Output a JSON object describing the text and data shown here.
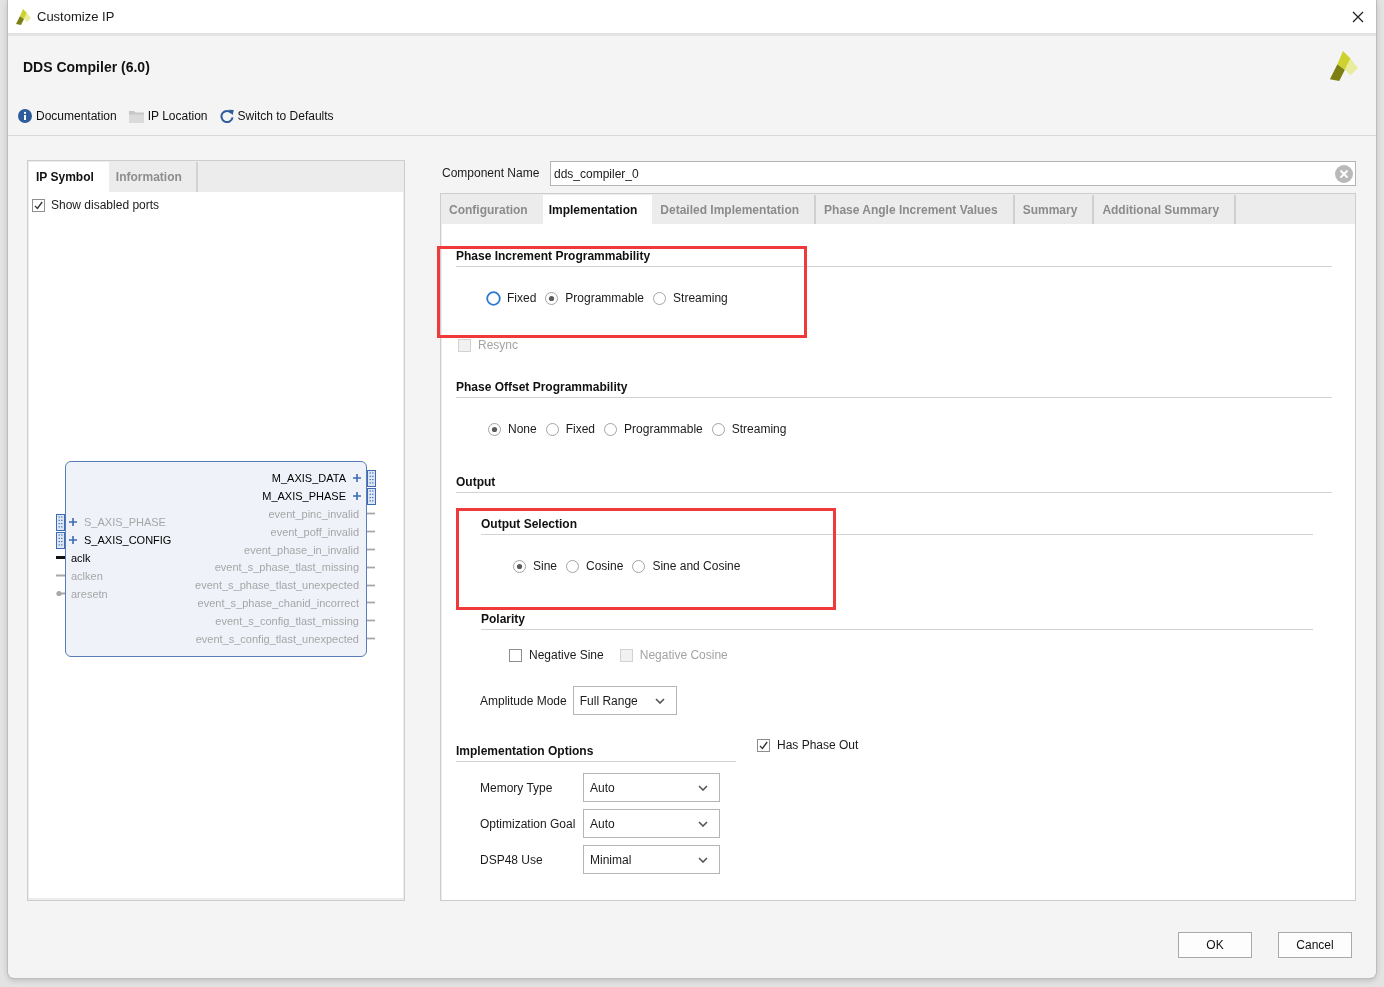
{
  "window": {
    "title": "Customize IP"
  },
  "header": {
    "title": "DDS Compiler (6.0)"
  },
  "toolbar": [
    {
      "kind": "info",
      "label": "Documentation"
    },
    {
      "kind": "folder",
      "label": "IP Location"
    },
    {
      "kind": "refresh",
      "label": "Switch to Defaults"
    }
  ],
  "left_panel": {
    "tabs": [
      {
        "label": "IP Symbol",
        "selected": true
      },
      {
        "label": "Information",
        "selected": false
      }
    ],
    "show_disabled_ports": {
      "label": "Show disabled ports",
      "checked": true
    },
    "symbol": {
      "left_ports": [
        {
          "name": "S_AXIS_PHASE",
          "kind": "bus",
          "disabled": true
        },
        {
          "name": "S_AXIS_CONFIG",
          "kind": "bus",
          "disabled": false
        },
        {
          "name": "aclk",
          "kind": "wire",
          "disabled": false
        },
        {
          "name": "aclken",
          "kind": "wire",
          "disabled": true
        },
        {
          "name": "aresetn",
          "kind": "active_low",
          "disabled": true
        }
      ],
      "right_ports": [
        {
          "name": "M_AXIS_DATA",
          "kind": "bus",
          "disabled": false
        },
        {
          "name": "M_AXIS_PHASE",
          "kind": "bus",
          "disabled": false
        },
        {
          "name": "event_pinc_invalid",
          "kind": "wire",
          "disabled": true
        },
        {
          "name": "event_poff_invalid",
          "kind": "wire",
          "disabled": true
        },
        {
          "name": "event_phase_in_invalid",
          "kind": "wire",
          "disabled": true
        },
        {
          "name": "event_s_phase_tlast_missing",
          "kind": "wire",
          "disabled": true
        },
        {
          "name": "event_s_phase_tlast_unexpected",
          "kind": "wire",
          "disabled": true
        },
        {
          "name": "event_s_phase_chanid_incorrect",
          "kind": "wire",
          "disabled": true
        },
        {
          "name": "event_s_config_tlast_missing",
          "kind": "wire",
          "disabled": true
        },
        {
          "name": "event_s_config_tlast_unexpected",
          "kind": "wire",
          "disabled": true
        }
      ]
    }
  },
  "component_name": {
    "label": "Component Name",
    "value": "dds_compiler_0"
  },
  "tabs": [
    {
      "label": "Configuration",
      "selected": false
    },
    {
      "label": "Implementation",
      "selected": true
    },
    {
      "label": "Detailed Implementation",
      "selected": false
    },
    {
      "label": "Phase Angle Increment Values",
      "selected": false
    },
    {
      "label": "Summary",
      "selected": false
    },
    {
      "label": "Additional Summary",
      "selected": false
    }
  ],
  "implementation": {
    "phase_increment": {
      "title": "Phase Increment Programmability",
      "highlighted": true,
      "options": [
        {
          "label": "Fixed",
          "selected": false,
          "focused": true
        },
        {
          "label": "Programmable",
          "selected": true,
          "focused": false
        },
        {
          "label": "Streaming",
          "selected": false,
          "focused": false
        }
      ]
    },
    "resync": {
      "label": "Resync",
      "checked": false,
      "disabled": true
    },
    "phase_offset": {
      "title": "Phase Offset Programmability",
      "options": [
        {
          "label": "None",
          "selected": true
        },
        {
          "label": "Fixed",
          "selected": false
        },
        {
          "label": "Programmable",
          "selected": false
        },
        {
          "label": "Streaming",
          "selected": false
        }
      ]
    },
    "output": {
      "title": "Output",
      "output_selection": {
        "title": "Output Selection",
        "highlighted": true,
        "options": [
          {
            "label": "Sine",
            "selected": true
          },
          {
            "label": "Cosine",
            "selected": false
          },
          {
            "label": "Sine and Cosine",
            "selected": false
          }
        ]
      },
      "polarity": {
        "title": "Polarity",
        "options": [
          {
            "label": "Negative Sine",
            "checked": false,
            "disabled": false
          },
          {
            "label": "Negative Cosine",
            "checked": false,
            "disabled": true
          }
        ]
      },
      "amplitude_mode": {
        "label": "Amplitude Mode",
        "value": "Full Range"
      }
    },
    "implementation_options": {
      "title": "Implementation Options",
      "fields": [
        {
          "label": "Memory Type",
          "value": "Auto"
        },
        {
          "label": "Optimization Goal",
          "value": "Auto"
        },
        {
          "label": "DSP48 Use",
          "value": "Minimal"
        }
      ]
    },
    "has_phase_out": {
      "label": "Has Phase Out",
      "checked": true,
      "disabled": false
    }
  },
  "buttons": [
    {
      "label": "OK"
    },
    {
      "label": "Cancel"
    }
  ]
}
